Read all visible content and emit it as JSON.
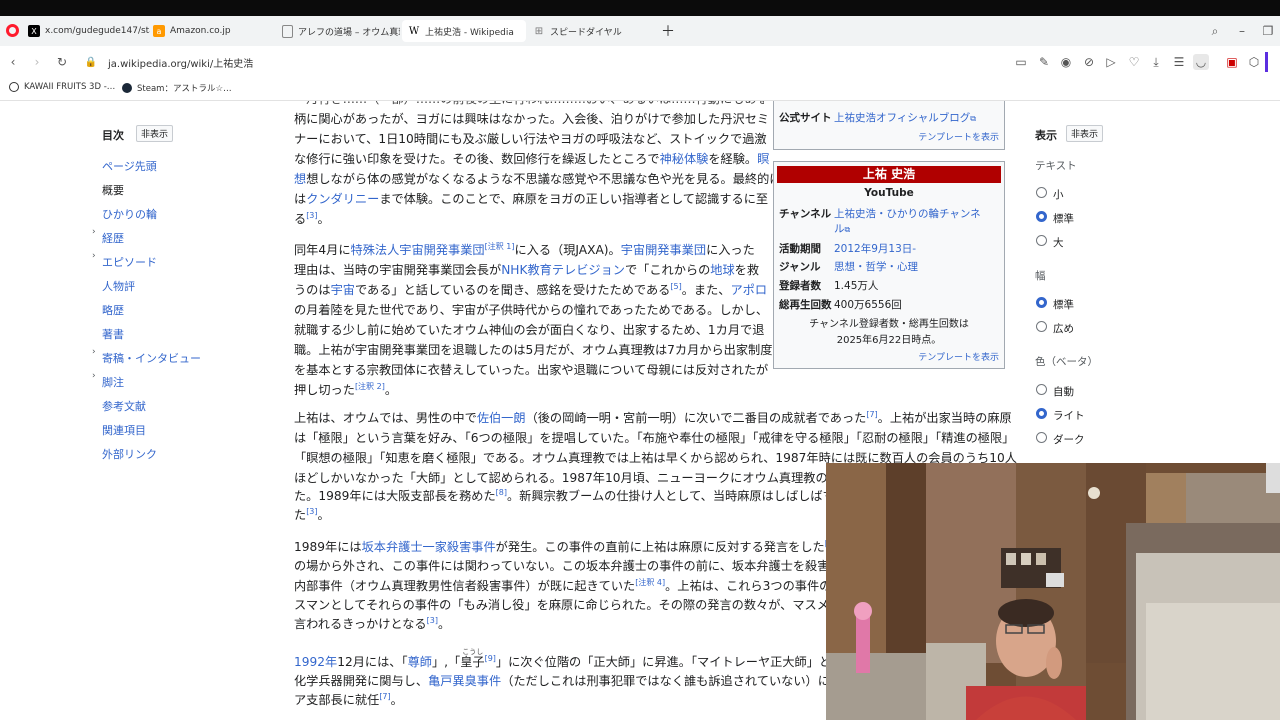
{
  "browser": {
    "tabs": [
      {
        "label": "x.com/gudegude147/stat…",
        "icon": "x-logo-icon",
        "color": "#000000"
      },
      {
        "label": "Amazon.co.jp",
        "icon": "amazon-icon",
        "color": "#ff9900"
      },
      {
        "label": "アレフの道場 – オウム真理教…",
        "icon": "page-icon",
        "color": "#888888"
      },
      {
        "label": "上祐史浩 - Wikipedia",
        "icon": "wikipedia-icon",
        "color": "#000000"
      },
      {
        "label": "スピードダイヤル",
        "icon": "grid-icon",
        "color": "#888888"
      }
    ],
    "address": "ja.wikipedia.org/wiki/上祐史浩",
    "bookmarks": [
      "KAWAII FRUITS 3D -…",
      "Steam：アストラル☆…"
    ]
  },
  "toc": {
    "title": "目次",
    "hide": "非表示",
    "items": [
      {
        "label": "ページ先頭",
        "expandable": false
      },
      {
        "label": "概要",
        "expandable": false,
        "current": true
      },
      {
        "label": "ひかりの輪",
        "expandable": false
      },
      {
        "label": "経歴",
        "expandable": true
      },
      {
        "label": "エピソード",
        "expandable": true
      },
      {
        "label": "人物評",
        "expandable": false
      },
      {
        "label": "略歴",
        "expandable": false
      },
      {
        "label": "著書",
        "expandable": false
      },
      {
        "label": "寄稿・インタビュー",
        "expandable": true
      },
      {
        "label": "脚注",
        "expandable": true
      },
      {
        "label": "参考文献",
        "expandable": false
      },
      {
        "label": "関連項目",
        "expandable": false
      },
      {
        "label": "外部リンク",
        "expandable": false
      }
    ]
  },
  "infobox1": {
    "label": "公式サイト",
    "value": "上祐史浩オフィシャルブログ",
    "template": "テンプレートを表示"
  },
  "infobox2": {
    "title": "上祐 史浩",
    "subtitle": "YouTube",
    "channel_label": "チャンネル",
    "channel_value1": "上祐史浩・ひかりの輪チャンネ",
    "channel_value2": "ル",
    "period_label": "活動期間",
    "period_value": "2012年9月13日-",
    "genre_label": "ジャンル",
    "genre_value": "思想・哲学・心理",
    "subs_label": "登録者数",
    "subs_value": "1.45万人",
    "views_label": "総再生回数",
    "views_value": "400万6556回",
    "note1": "チャンネル登録者数・総再生回数は",
    "note2": "2025年6月22日時点。",
    "template": "テンプレートを表示"
  },
  "article": {
    "p1": [
      "一月行き……（一部）……の前後の主に行われ………おい、あるいは……行動にもある…",
      "柄に関心があったが、ヨガには興味はなかった。入会後、泊りがけで参加した丹沢セミ",
      "ナーにおいて、1日10時間にも及ぶ厳しい行法やヨガの呼吸法など、ストイックで過激",
      "な修行に強い印象を受けた。その後、数回修行を繰返したところで",
      "想しながら体の感覚がなくなるような不思議な感覚や不思議な色や光を見る。最終的に",
      "は",
      "まで体験。このことで、麻原をヨガの正しい指導者として認識するに至",
      "る"
    ],
    "p1_links": {
      "mystic": "神秘体験",
      "mei": "瞑",
      "kundalini": "クンダリニー"
    },
    "p2": [
      "同年4月に",
      "特殊法人宇宙開発事業団",
      "に入る（現JAXA)。",
      "宇宙開発事業団",
      "に入った",
      "理由は、当時の宇宙開発事業団会長が",
      "NHK教育テレビジョン",
      "で「これからの",
      "地球",
      "を救",
      "うのは",
      "宇宙",
      "である」と話しているのを聞き、感銘を受けたためである",
      "。また、",
      "アポロ",
      "の月着陸を見た世代であり、宇宙が子供時代からの憧れであったためである。しかし、",
      "就職する少し前に始めていたオウム神仙の会が面白くなり、出家するため、1カ月で退",
      "職。上祐が宇宙開発事業団を退職したのは5月だが、オウム真理教は7カ月から出家制度",
      "を基本とする宗教団体に衣替えしていった。出家や退職について母親には反対されたが",
      "押し切った"
    ],
    "p3": [
      "上祐は、オウムでは、男性の中で",
      "佐伯一朗",
      "（後の岡崎一明・宮前一明）に次いで二番目の成就者であった",
      "。上祐が出家当時の麻原",
      "は「極限」という言葉を好み、「6つの極限」を提唱していた。「布施や奉仕の極限」「戒律を守る極限」「忍耐の極限」「精進の極限」",
      "「瞑想の極限」「知恵を磨く極限」である。オウム真理教では上祐は早くから認められ、1987年時には既に数百人の会員のうち10人",
      "ほどしかいなかった「大師」として認められる。1987年10月頃、ニューヨークにオウム真理教の支部を",
      "た。1989年には大阪支部長を務めた",
      "。新興宗教ブームの仕掛け人として、当時麻原はしばしばマ",
      "た"
    ],
    "p4": [
      "1989年には",
      "坂本弁護士一家殺害事件",
      "が発生。この事件の直前に上祐は麻原に反対する発言をした",
      "の場から外され、この事件には関わっていない。この坂本弁護士の事件の前に、坂本弁護士を殺害",
      "内部事件（オウム真理教男性信者殺害事件）が既に起きていた",
      "。上祐は、これら3つの事件の",
      "スマンとしてそれらの事件の「もみ消し役」を麻原に命じられた。その際の発言の数々が、マスメ",
      "言われるきっかけとなる"
    ],
    "p5": [
      "1992年",
      "12月には、「",
      "尊師",
      "」,「",
      "皇子",
      "こうし",
      "」に次ぐ位階の「正大師」に昇進。「マイトレーヤ正大師」とし",
      "化学兵器開発に関与し、",
      "亀戸異臭事件",
      "（ただしこれは刑事犯罪ではなく誰も訴追されていない）に",
      "ア支部長に就任"
    ],
    "refs": {
      "r3": "[3]",
      "n1": "[注釈 1]",
      "r5": "[5]",
      "n2": "[注釈 2]",
      "r7": "[7]",
      "r8": "[8]",
      "n3": "[注",
      "n4": "[注釈 4]",
      "r9": "[9]"
    }
  },
  "appearance": {
    "title": "表示",
    "hide": "非表示",
    "text_heading": "テキスト",
    "text_options": [
      "小",
      "標準",
      "大"
    ],
    "text_selected": 1,
    "width_heading": "幅",
    "width_options": [
      "標準",
      "広め"
    ],
    "width_selected": 0,
    "color_heading": "色（ベータ）",
    "color_options": [
      "自動",
      "ライト",
      "ダーク"
    ],
    "color_selected": 1
  },
  "colors": {
    "accent": "#3366cc",
    "infobox_header": "#b00000",
    "tabbar": "#f1f3f4",
    "opera": "#ff1b2d"
  }
}
